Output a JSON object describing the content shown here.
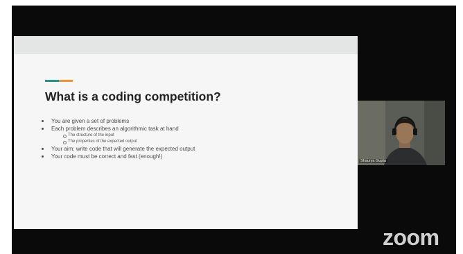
{
  "slide": {
    "title": "What is a coding competition?",
    "accent_colors": [
      "#2a8e8a",
      "#e8953a"
    ],
    "bullets": [
      {
        "text": "You are given a set of problems"
      },
      {
        "text": "Each problem describes an algorithmic task at hand",
        "sub": [
          "The structure of the input",
          "The properties of the expected output"
        ]
      },
      {
        "text": "Your aim: write code that will generate the expected output"
      },
      {
        "text": "Your code must be correct and fast (enough!)"
      }
    ]
  },
  "participant": {
    "name": "Shaurya Gupta"
  },
  "branding": {
    "logo": "zoom"
  }
}
